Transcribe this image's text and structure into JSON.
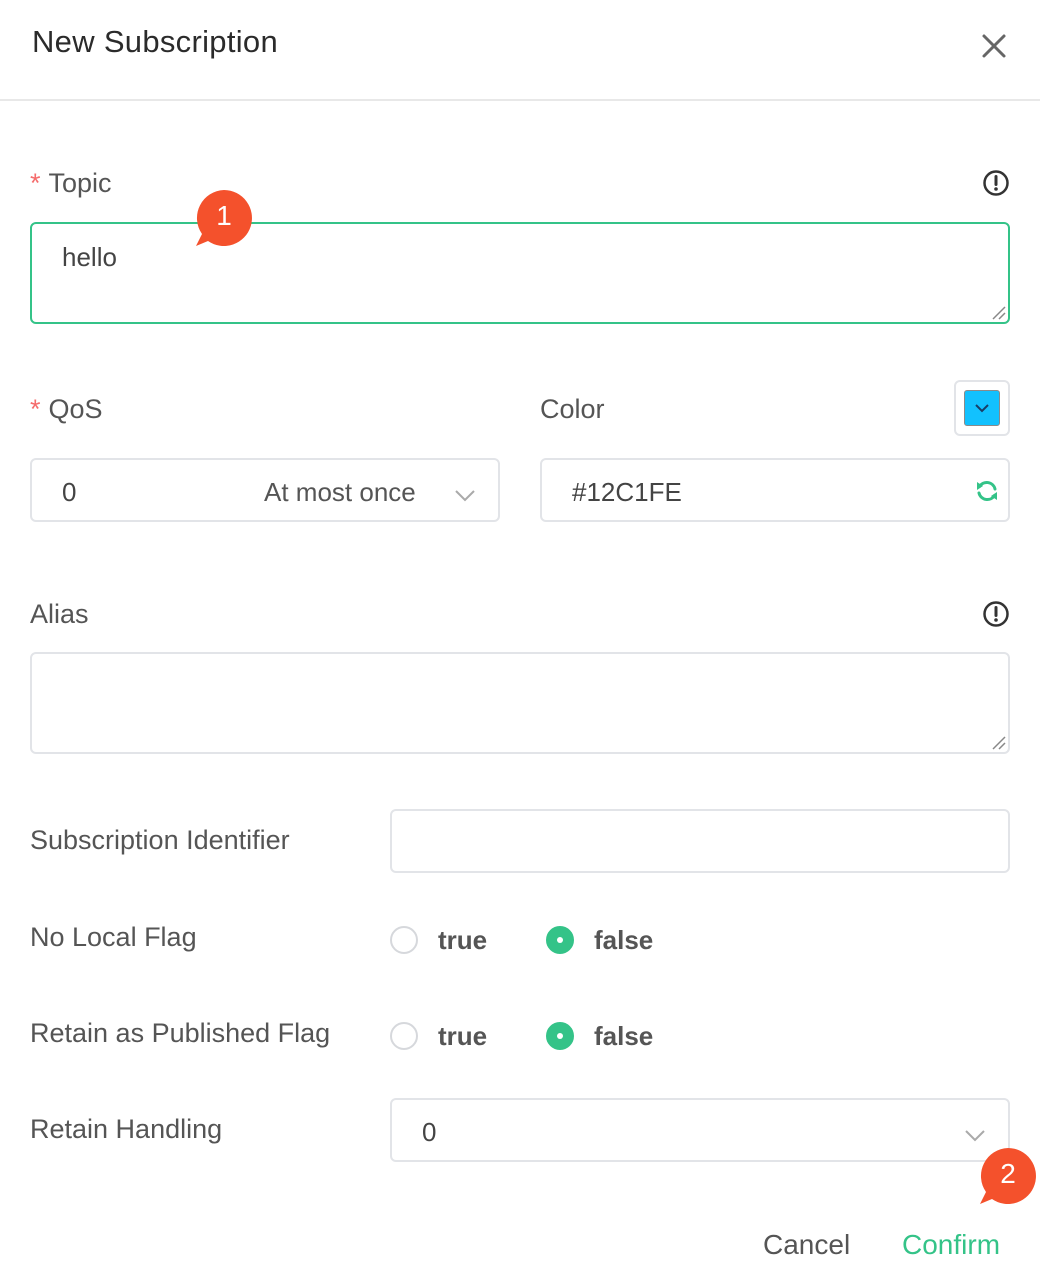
{
  "dialog": {
    "title": "New Subscription"
  },
  "topic": {
    "label": "Topic",
    "required_mark": "*",
    "value": "hello"
  },
  "qos": {
    "label": "QoS",
    "required_mark": "*",
    "selected_value": "0",
    "selected_desc": "At most once"
  },
  "color": {
    "label": "Color",
    "value": "#12C1FE",
    "swatch_hex": "#12C1FE"
  },
  "alias": {
    "label": "Alias",
    "value": ""
  },
  "subscription_identifier": {
    "label": "Subscription Identifier",
    "value": ""
  },
  "no_local_flag": {
    "label": "No Local Flag",
    "options": [
      "true",
      "false"
    ],
    "selected": "false"
  },
  "retain_as_published": {
    "label": "Retain as Published Flag",
    "options": [
      "true",
      "false"
    ],
    "selected": "false"
  },
  "retain_handling": {
    "label": "Retain Handling",
    "value": "0"
  },
  "footer": {
    "cancel_label": "Cancel",
    "confirm_label": "Confirm"
  },
  "badges": [
    "1",
    "2"
  ],
  "colors": {
    "accent": "#34C388",
    "badge": "#F4512C",
    "required": "#F56C6C"
  }
}
